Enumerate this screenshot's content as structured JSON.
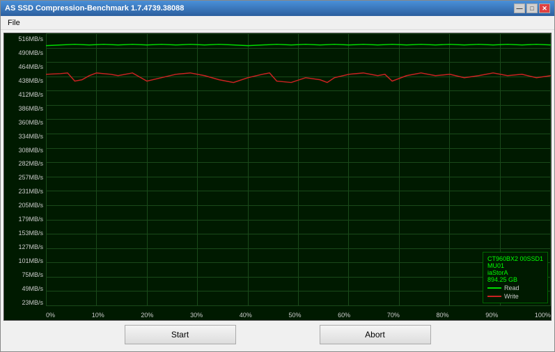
{
  "window": {
    "title": "AS SSD Compression-Benchmark 1.7.4739.38088",
    "min_btn": "—",
    "max_btn": "□",
    "close_btn": "✕"
  },
  "menu": {
    "file_label": "File"
  },
  "yaxis": {
    "labels": [
      "516MB/s",
      "490MB/s",
      "464MB/s",
      "438MB/s",
      "412MB/s",
      "386MB/s",
      "360MB/s",
      "334MB/s",
      "308MB/s",
      "282MB/s",
      "257MB/s",
      "231MB/s",
      "205MB/s",
      "179MB/s",
      "153MB/s",
      "127MB/s",
      "101MB/s",
      "75MB/s",
      "49MB/s",
      "23MB/s"
    ]
  },
  "xaxis": {
    "labels": [
      "0%",
      "10%",
      "20%",
      "30%",
      "40%",
      "50%",
      "60%",
      "70%",
      "80%",
      "90%",
      "100%"
    ]
  },
  "legend": {
    "drive": "CT960BX2 00SSD1",
    "firmware": "MU01",
    "controller": "iaStorA",
    "size": "894.25 GB",
    "read_label": "Read",
    "write_label": "Write",
    "read_color": "#00cc00",
    "write_color": "#cc3333"
  },
  "buttons": {
    "start_label": "Start",
    "abort_label": "Abort"
  },
  "chart": {
    "bg": "#001a00",
    "read_color": "#00dd00",
    "write_color": "#cc2222"
  }
}
